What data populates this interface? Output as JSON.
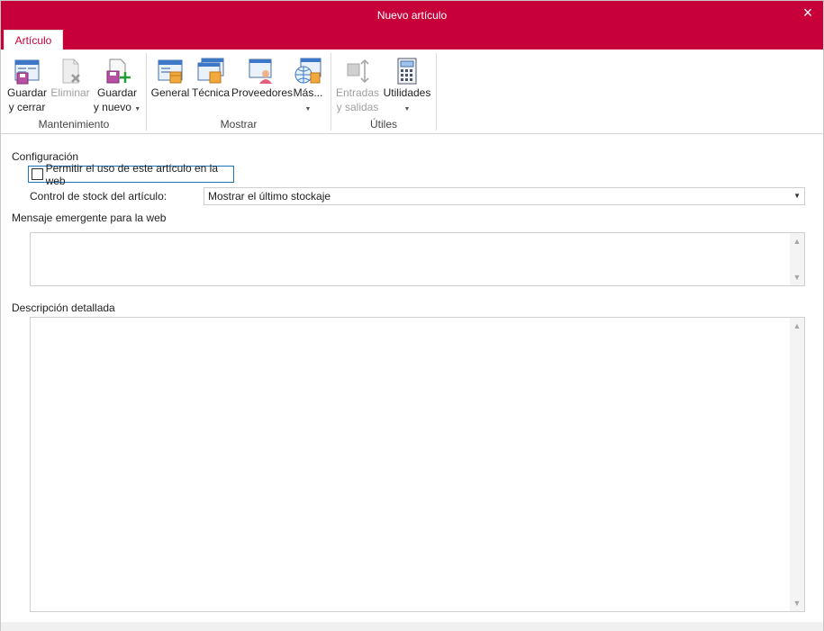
{
  "window": {
    "title": "Nuevo artículo",
    "close_icon": "×",
    "accent_color": "#c8003a"
  },
  "tabs": [
    {
      "label": "Artículo"
    }
  ],
  "ribbon": {
    "groups": [
      {
        "label": "Mantenimiento"
      },
      {
        "label": "Mostrar"
      },
      {
        "label": "Útiles"
      }
    ],
    "buttons": {
      "guardar_cerrar": {
        "line1": "Guardar",
        "line2": "y cerrar",
        "icon": "save-close-icon"
      },
      "eliminar": {
        "line1": "Eliminar",
        "icon": "delete-icon",
        "disabled": true
      },
      "guardar_nuevo": {
        "line1": "Guardar",
        "line2": "y nuevo",
        "icon": "save-new-icon"
      },
      "general": {
        "line1": "General",
        "icon": "general-icon"
      },
      "tecnica": {
        "line1": "Técnica",
        "icon": "technical-icon"
      },
      "proveedores": {
        "line1": "Proveedores",
        "icon": "suppliers-icon"
      },
      "mas": {
        "line1": "Más...",
        "icon": "more-globe-icon"
      },
      "entradas_salidas": {
        "line1": "Entradas",
        "line2": "y salidas",
        "icon": "in-out-icon",
        "disabled": true
      },
      "utilidades": {
        "line1": "Utilidades",
        "icon": "calculator-icon"
      }
    }
  },
  "form": {
    "configuracion_label": "Configuración",
    "web_checkbox_label": "Permitir el uso de este artículo en la web",
    "web_checkbox_checked": false,
    "stock_control_label": "Control de stock del artículo:",
    "stock_control_value": "Mostrar el último stockaje",
    "popup_message_label": "Mensaje emergente para la web",
    "popup_message_value": "",
    "detailed_description_label": "Descripción detallada",
    "detailed_description_value": ""
  }
}
